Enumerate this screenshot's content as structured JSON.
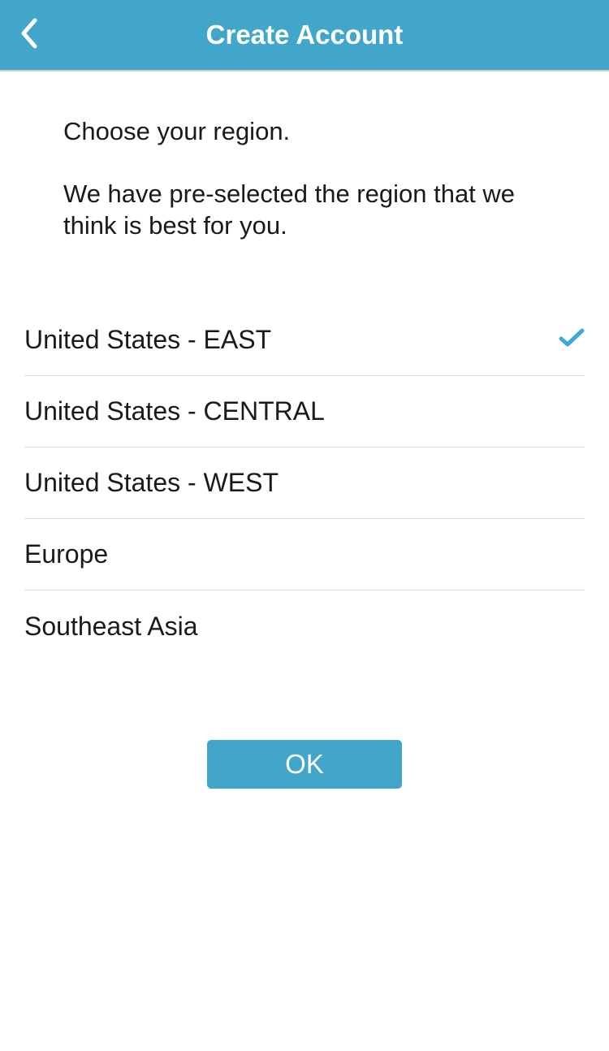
{
  "header": {
    "title": "Create Account"
  },
  "intro": {
    "line1": "Choose your region.",
    "line2": "We have pre-selected the region that we think is best for you."
  },
  "regions": [
    {
      "label": "United States - EAST",
      "selected": true
    },
    {
      "label": "United States - CENTRAL",
      "selected": false
    },
    {
      "label": "United States - WEST",
      "selected": false
    },
    {
      "label": "Europe",
      "selected": false
    },
    {
      "label": "Southeast Asia",
      "selected": false
    }
  ],
  "buttons": {
    "ok": "OK"
  },
  "colors": {
    "accent": "#42a5ca"
  }
}
